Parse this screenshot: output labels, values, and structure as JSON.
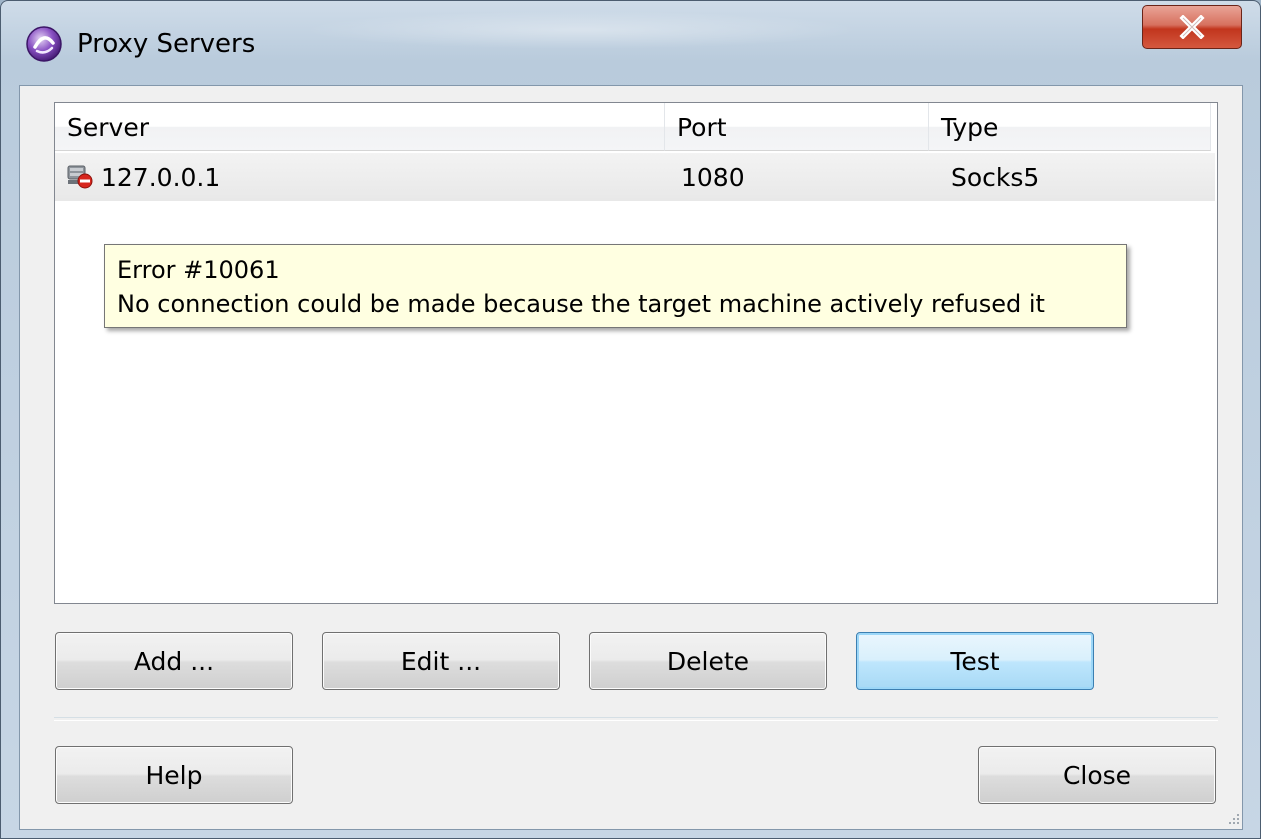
{
  "window": {
    "title": "Proxy Servers",
    "icons": {
      "app": "proxifier-app-icon",
      "close": "close-icon"
    }
  },
  "list": {
    "columns": [
      "Server",
      "Port",
      "Type"
    ],
    "rows": [
      {
        "server": "127.0.0.1",
        "port": "1080",
        "type": "Socks5",
        "status_icon": "server-error-icon"
      }
    ]
  },
  "tooltip": {
    "line1": "Error #10061",
    "line2": "No connection could be made because the target machine actively refused it"
  },
  "buttons": {
    "add": "Add ...",
    "edit": "Edit ...",
    "delete": "Delete",
    "test": "Test",
    "help": "Help",
    "close": "Close"
  },
  "colors": {
    "close_button": "#c2351d",
    "tooltip_bg": "#ffffe1",
    "default_button_border": "#3c7fb1"
  }
}
